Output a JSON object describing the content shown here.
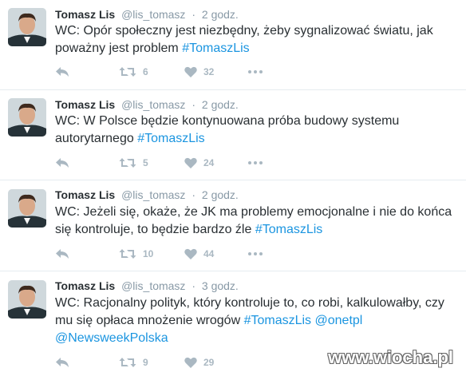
{
  "tweets": [
    {
      "name": "Tomasz Lis",
      "handle": "@lis_tomasz",
      "separator": "·",
      "time": "2 godz.",
      "text_pre": "WC: Opór społeczny jest niezbędny, żeby sygnalizować światu, jak poważny jest problem ",
      "tags": [
        "#TomaszLis"
      ],
      "retweets": "6",
      "likes": "32"
    },
    {
      "name": "Tomasz Lis",
      "handle": "@lis_tomasz",
      "separator": "·",
      "time": "2 godz.",
      "text_pre": "WC: W Polsce będzie kontynuowana próba budowy systemu autorytarnego ",
      "tags": [
        "#TomaszLis"
      ],
      "retweets": "5",
      "likes": "24"
    },
    {
      "name": "Tomasz Lis",
      "handle": "@lis_tomasz",
      "separator": "·",
      "time": "2 godz.",
      "text_pre": "WC: Jeżeli się, okaże, że JK ma problemy emocjonalne i nie do końca się kontroluje, to będzie bardzo źle ",
      "tags": [
        "#TomaszLis"
      ],
      "retweets": "10",
      "likes": "44"
    },
    {
      "name": "Tomasz Lis",
      "handle": "@lis_tomasz",
      "separator": "·",
      "time": "3 godz.",
      "text_pre": "WC: Racjonalny polityk, który kontroluje to, co robi, kalkulowałby, czy mu się opłaca mnożenie wrogów ",
      "tags": [
        "#TomaszLis",
        "@onetpl",
        "@NewsweekPolska"
      ],
      "retweets": "9",
      "likes": "29"
    }
  ],
  "icons": {
    "reply": "reply-arrow",
    "retweet": "retweet-arrows",
    "like": "heart",
    "more": "three-dots"
  },
  "colors": {
    "link": "#1b95e0",
    "muted": "#8899a6",
    "icon": "#aab8c2",
    "text": "#292f33"
  },
  "watermark": "www.wiocha.pl"
}
